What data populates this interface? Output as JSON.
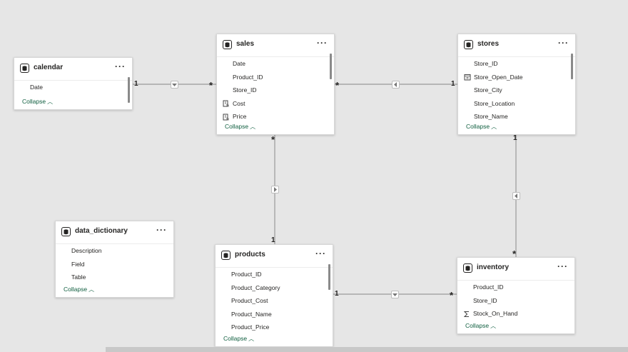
{
  "tables": [
    {
      "id": "calendar",
      "title": "calendar",
      "fields": [
        {
          "name": "Date",
          "icon": ""
        }
      ],
      "collapse_label": "Collapse"
    },
    {
      "id": "sales",
      "title": "sales",
      "fields": [
        {
          "name": "Date",
          "icon": ""
        },
        {
          "name": "Product_ID",
          "icon": ""
        },
        {
          "name": "Store_ID",
          "icon": ""
        },
        {
          "name": "Cost",
          "icon": "calculated-column-icon"
        },
        {
          "name": "Price",
          "icon": "calculated-column-icon"
        }
      ],
      "collapse_label": "Collapse"
    },
    {
      "id": "stores",
      "title": "stores",
      "fields": [
        {
          "name": "Store_ID",
          "icon": ""
        },
        {
          "name": "Store_Open_Date",
          "icon": "calendar-icon"
        },
        {
          "name": "Store_City",
          "icon": ""
        },
        {
          "name": "Store_Location",
          "icon": ""
        },
        {
          "name": "Store_Name",
          "icon": ""
        }
      ],
      "collapse_label": "Collapse"
    },
    {
      "id": "data_dictionary",
      "title": "data_dictionary",
      "fields": [
        {
          "name": "Description",
          "icon": ""
        },
        {
          "name": "Field",
          "icon": ""
        },
        {
          "name": "Table",
          "icon": ""
        }
      ],
      "collapse_label": "Collapse"
    },
    {
      "id": "products",
      "title": "products",
      "fields": [
        {
          "name": "Product_ID",
          "icon": ""
        },
        {
          "name": "Product_Category",
          "icon": ""
        },
        {
          "name": "Product_Cost",
          "icon": ""
        },
        {
          "name": "Product_Name",
          "icon": ""
        },
        {
          "name": "Product_Price",
          "icon": ""
        }
      ],
      "collapse_label": "Collapse"
    },
    {
      "id": "inventory",
      "title": "inventory",
      "fields": [
        {
          "name": "Product_ID",
          "icon": ""
        },
        {
          "name": "Store_ID",
          "icon": ""
        },
        {
          "name": "Stock_On_Hand",
          "icon": "sigma-icon"
        }
      ],
      "collapse_label": "Collapse"
    }
  ],
  "more_label": "···",
  "relationships": [
    {
      "from": "calendar",
      "to": "sales",
      "from_cardinality": "1",
      "to_cardinality": "*",
      "filter_direction": "down-arrow-icon"
    },
    {
      "from": "sales",
      "to": "stores",
      "from_cardinality": "*",
      "to_cardinality": "1",
      "filter_direction": "left-arrow-icon"
    },
    {
      "from": "sales",
      "to": "products",
      "from_cardinality": "*",
      "to_cardinality": "1",
      "filter_direction": "right-arrow-icon"
    },
    {
      "from": "stores",
      "to": "inventory",
      "from_cardinality": "1",
      "to_cardinality": "*",
      "filter_direction": "left-arrow-icon"
    },
    {
      "from": "products",
      "to": "inventory",
      "from_cardinality": "1",
      "to_cardinality": "*",
      "filter_direction": "down-arrow-icon"
    }
  ],
  "colors": {
    "canvas": "#e6e6e6",
    "card": "#ffffff",
    "collapse_link": "#0f5e3f",
    "line": "#8c8c8c"
  }
}
